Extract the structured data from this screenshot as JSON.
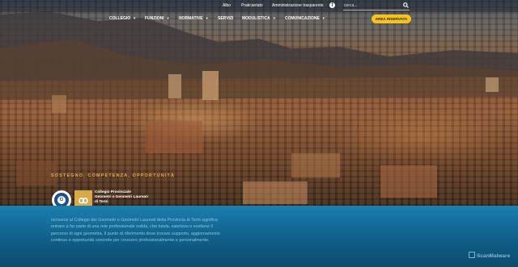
{
  "topbar": {
    "links": [
      "Albo",
      "Praticantato",
      "Amministrazione trasparente"
    ],
    "facebook_icon": "facebook-icon",
    "search": {
      "placeholder": "cerca...",
      "icon": "search-icon"
    }
  },
  "nav": {
    "items": [
      {
        "label": "COLLEGIO",
        "dropdown": true
      },
      {
        "label": "FUNZIONI",
        "dropdown": true
      },
      {
        "label": "NORMATIVE",
        "dropdown": true
      },
      {
        "label": "SERVIZI",
        "dropdown": false
      },
      {
        "label": "MODULISTICA",
        "dropdown": true
      },
      {
        "label": "COMUNICAZIONE",
        "dropdown": true
      }
    ],
    "area_button": "AREA RISERVATA",
    "dropdown_icon": "caret-down-icon"
  },
  "hero": {
    "tagline": "SOSTEGNO, COMPETENZA, OPPORTUNITÀ",
    "org_lines": [
      "Collegio Provinciale",
      "Geometri e Geometri Laureati",
      "di Terni"
    ],
    "logo_icon": "collegio-seal-logo",
    "logo_glyph": "G",
    "logo2_glyph": "ꝏ"
  },
  "description": "Iscriversi al Collegio dei Geometri e Geometri Laureati della Provincia di Terni significa entrare a far parte di una rete professionale solida, che tutela, valorizza e sostiene il percorso di ogni geometra. Il punto di riferimento dove trovare supporto, aggiornamento continuo e opportunità concrete per crescere professionalmente e personalmente.",
  "watermark": "ScanMalware",
  "colors": {
    "accent_yellow": "#f6c21b",
    "tagline_gold": "#d9b04c",
    "band_blue": "#1c7fb0"
  }
}
